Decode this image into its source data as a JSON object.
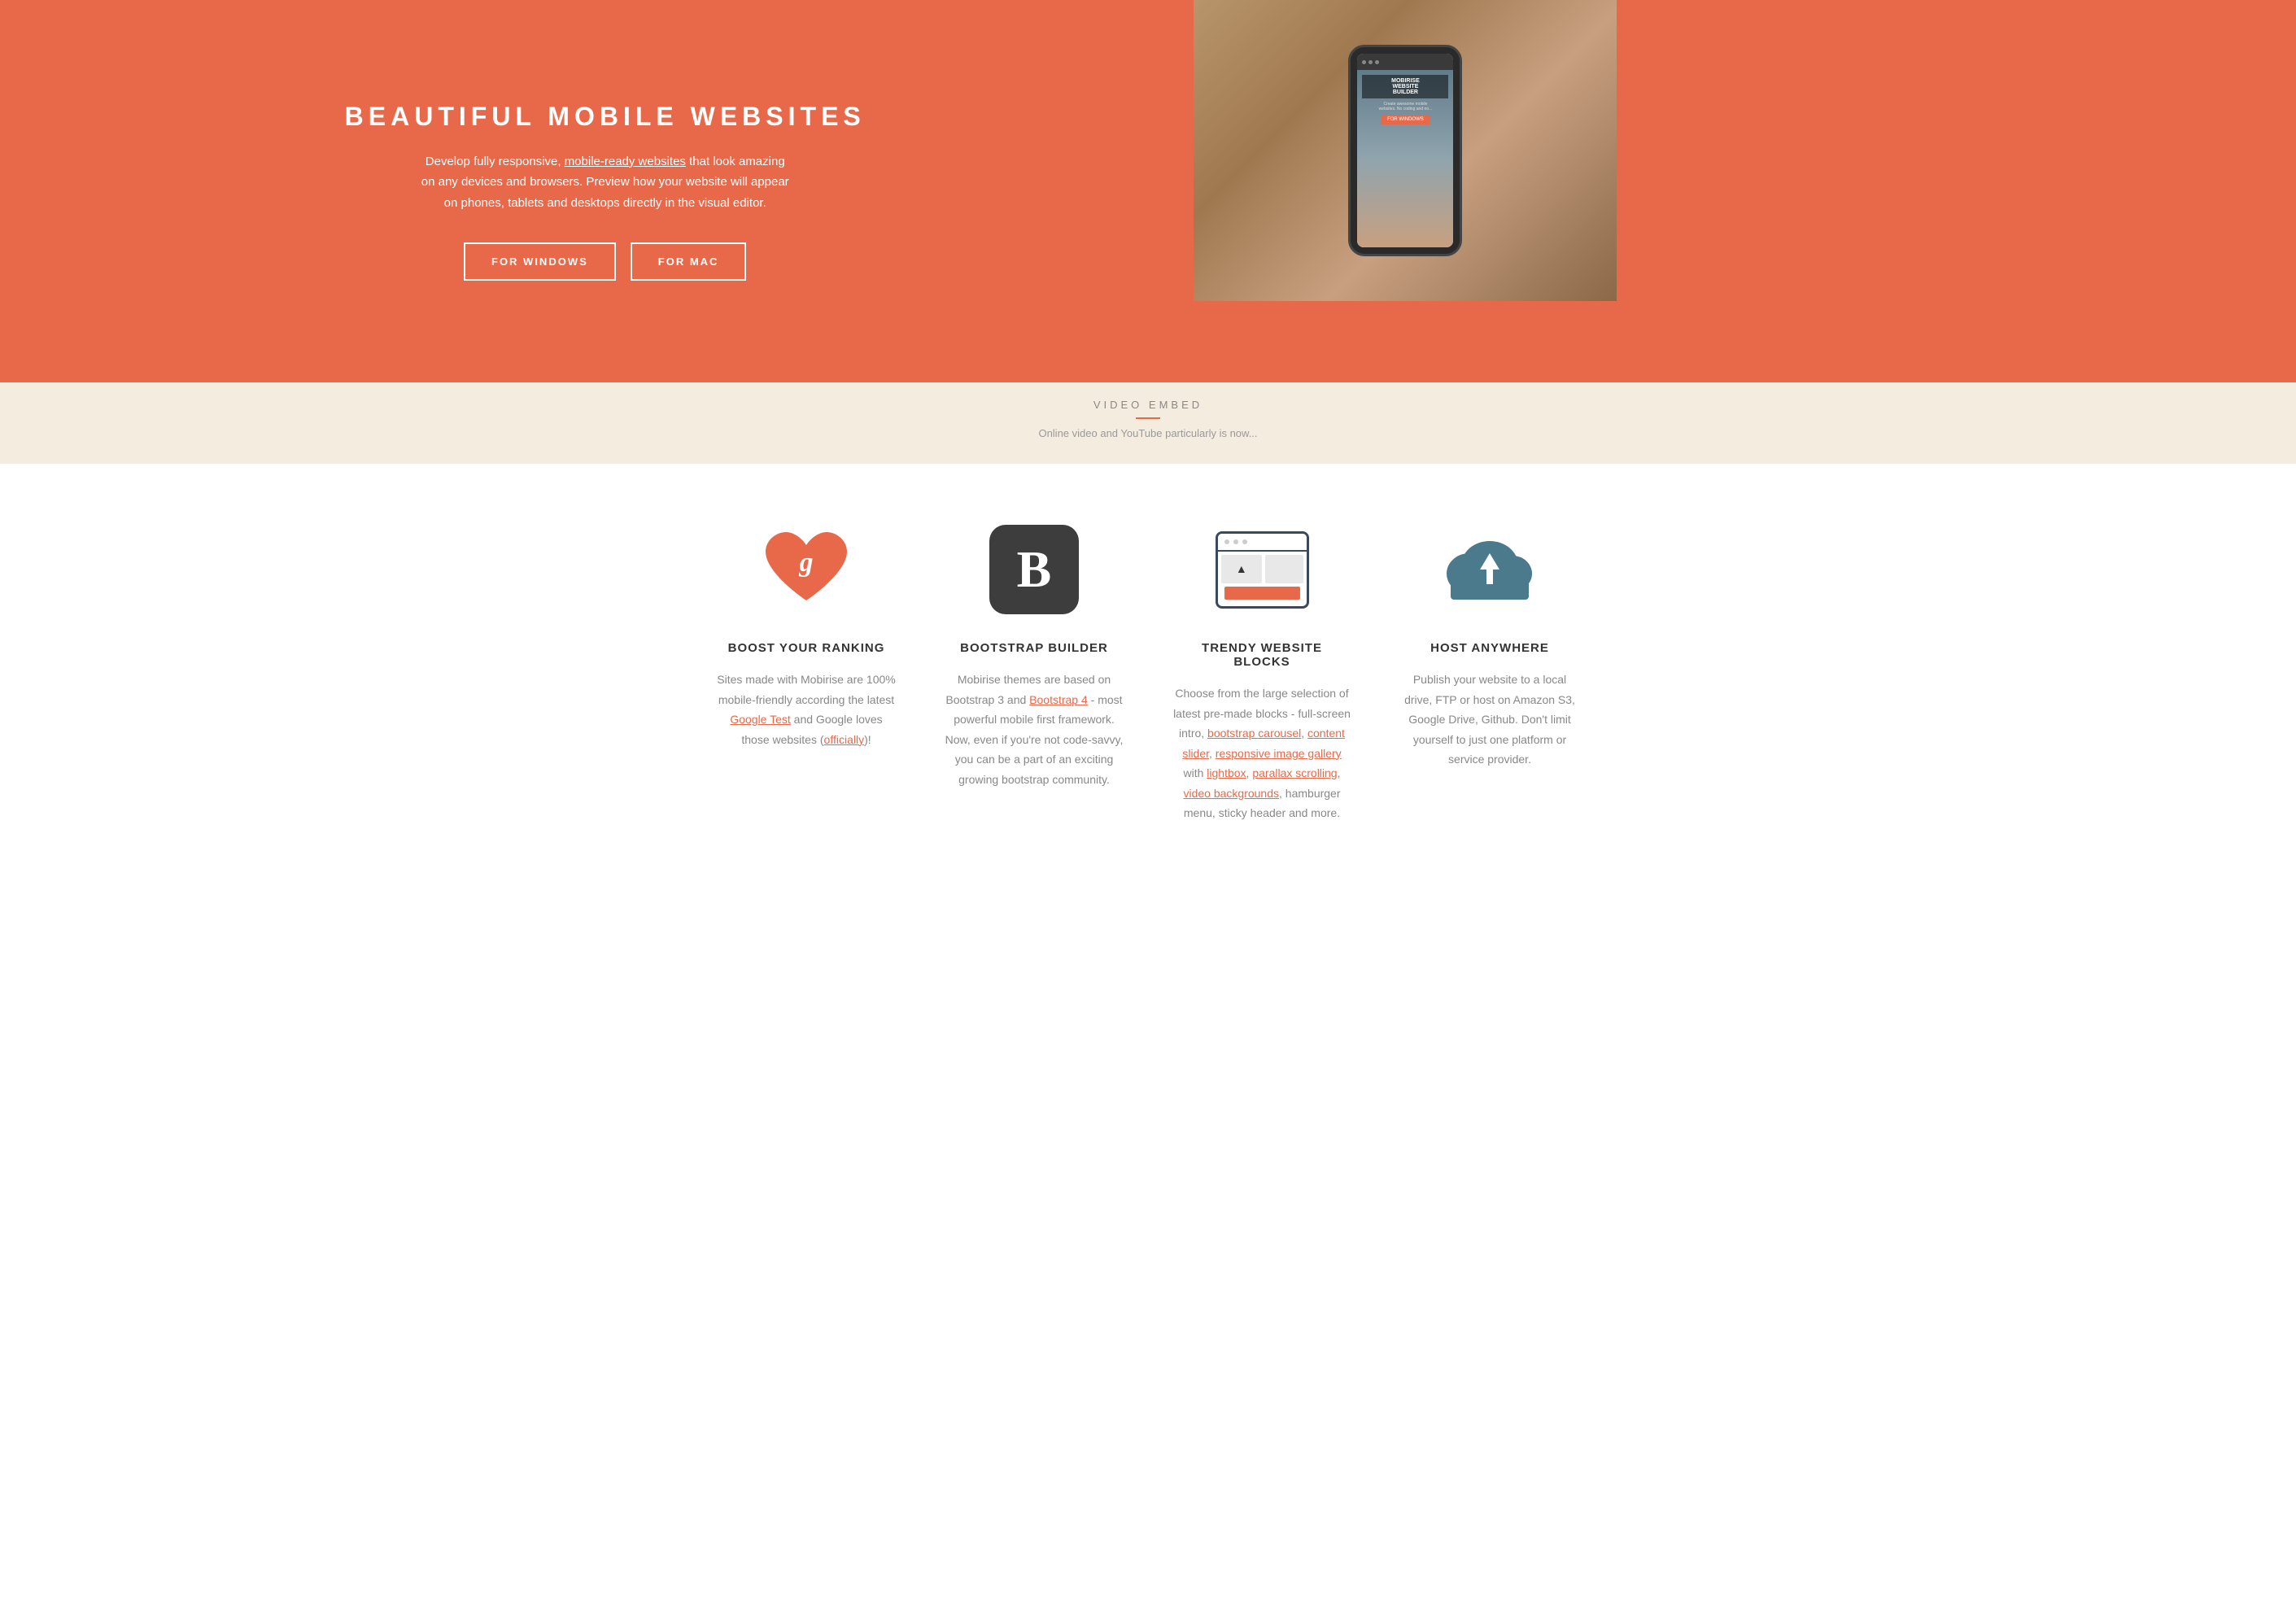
{
  "hero": {
    "title": "BEAUTIFUL MOBILE WEBSITES",
    "description_text": "Develop fully responsive, mobile-ready websites that look amazing on any devices and browsers. Preview how your website will appear on phones, tablets and desktops directly in the visual editor.",
    "mobile_ready_link": "mobile-ready websites",
    "btn_windows": "FOR WINDOWS",
    "btn_mac": "FOR MAC",
    "phone_label": "MOBIRISE WEBSITE BUILDER",
    "phone_sublabel": "Create awesome mobile websites. No coding and no..."
  },
  "video_embed": {
    "label": "VIDEO EMBED",
    "description": "Online video and YouTube particularly is now..."
  },
  "features": [
    {
      "id": "boost-ranking",
      "icon": "heart-google",
      "title": "BOOST YOUR RANKING",
      "description": "Sites made with Mobirise are 100% mobile-friendly according the latest ",
      "link1_text": "Google Test",
      "link1_href": "#",
      "mid_text": " and Google loves those websites (",
      "link2_text": "officially",
      "link2_href": "#",
      "end_text": ")!"
    },
    {
      "id": "bootstrap-builder",
      "icon": "bootstrap-b",
      "title": "BOOTSTRAP BUILDER",
      "description": "Mobirise themes are based on Bootstrap 3 and ",
      "link1_text": "Bootstrap 4",
      "link1_href": "#",
      "mid_text": " - most powerful mobile first framework. Now, even if you're not code-savvy, you can be a part of an exciting growing bootstrap community.",
      "link2_text": "",
      "link2_href": "",
      "end_text": ""
    },
    {
      "id": "trendy-blocks",
      "icon": "browser-blocks",
      "title": "TRENDY WEBSITE BLOCKS",
      "description": "Choose from the large selection of latest pre-made blocks - full-screen intro, ",
      "link1_text": "bootstrap carousel",
      "link1_href": "#",
      "sep1": ", ",
      "link2_text": "content slider",
      "link2_href": "#",
      "sep2": ", ",
      "link3_text": "responsive image gallery",
      "link3_href": "#",
      "mid_text": " with ",
      "link4_text": "lightbox",
      "link4_href": "#",
      "sep3": ", ",
      "link5_text": "parallax scrolling",
      "link5_href": "#",
      "sep4": ", ",
      "link6_text": "video backgrounds",
      "link6_href": "#",
      "end_text": ", hamburger menu, sticky header and more."
    },
    {
      "id": "host-anywhere",
      "icon": "cloud-upload",
      "title": "HOST ANYWHERE",
      "description": "Publish your website to a local drive, FTP or host on Amazon S3, Google Drive, Github. Don't limit yourself to just one platform or service provider."
    }
  ],
  "colors": {
    "accent": "#e8694a",
    "dark": "#3a3a3a",
    "teal": "#4a7a8c",
    "text_muted": "#888888",
    "text_dark": "#333333"
  }
}
